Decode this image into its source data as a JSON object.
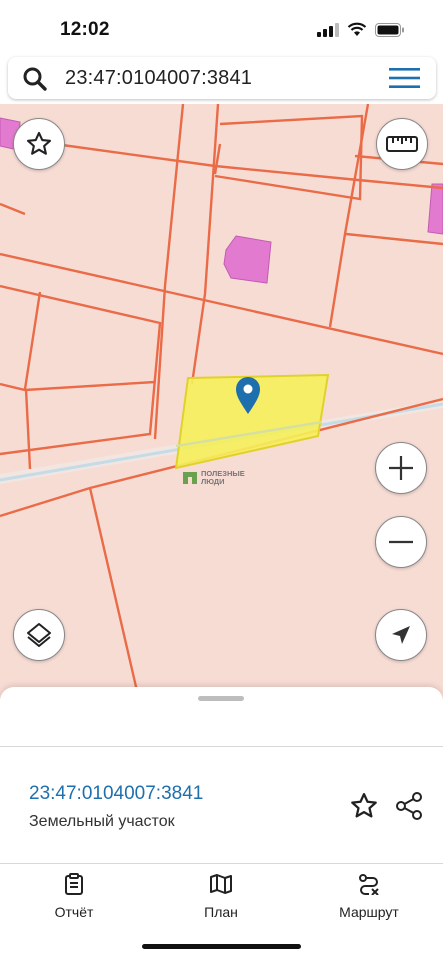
{
  "status_bar": {
    "time": "12:02"
  },
  "search": {
    "query": "23:47:0104007:3841"
  },
  "map": {
    "watermark_line1": "ПОЛЕЗНЫЕ",
    "watermark_line2": "ЛЮДИ",
    "colors": {
      "background": "#f7dcd4",
      "parcel_border": "#ea6b47",
      "selected_fill": "#f5ef5c",
      "building": "#e27ad0",
      "road": "#c5dbe6",
      "pin": "#1e6fae"
    }
  },
  "controls": {
    "favorite": "star-icon",
    "ruler": "ruler-icon",
    "zoom_in": "plus-icon",
    "zoom_out": "minus-icon",
    "layers": "layers-icon",
    "locate": "navigation-arrow-icon"
  },
  "sheet": {
    "cadastral_number": "23:47:0104007:3841",
    "object_type": "Земельный участок"
  },
  "tabs": [
    {
      "label": "Отчёт",
      "icon": "clipboard-icon"
    },
    {
      "label": "План",
      "icon": "map-icon"
    },
    {
      "label": "Маршрут",
      "icon": "route-icon"
    }
  ]
}
